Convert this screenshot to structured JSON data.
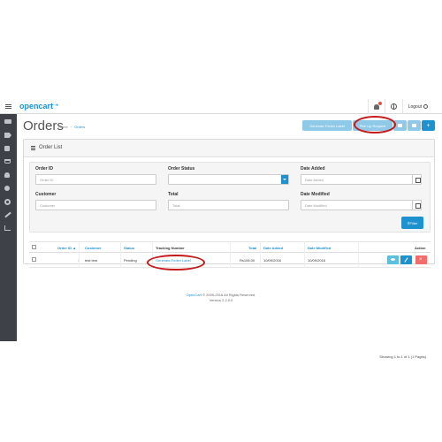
{
  "header": {
    "logo_text": "opencart",
    "logout_label": "Logout"
  },
  "sidebar": {
    "items": [
      {
        "icon": "dashboard-icon"
      },
      {
        "icon": "tag-icon"
      },
      {
        "icon": "puzzle-icon"
      },
      {
        "icon": "shopping-cart-icon"
      },
      {
        "icon": "user-icon"
      },
      {
        "icon": "share-icon"
      },
      {
        "icon": "cog-icon"
      },
      {
        "icon": "wrench-icon"
      },
      {
        "icon": "bar-chart-icon"
      }
    ]
  },
  "page": {
    "title": "Orders",
    "breadcrumb": [
      "Home",
      "Orders"
    ]
  },
  "top_actions": {
    "fedex_label": "Generate Fedex Label",
    "pickup_label": "Pick Up Request",
    "add_label": "+"
  },
  "panel": {
    "title": "Order List"
  },
  "filter": {
    "order_id_label": "Order ID",
    "order_id_placeholder": "Order ID",
    "order_status_label": "Order Status",
    "order_status_value": "",
    "date_added_label": "Date Added",
    "date_added_placeholder": "Date Added",
    "customer_label": "Customer",
    "customer_placeholder": "Customer",
    "total_label": "Total",
    "total_placeholder": "Total",
    "date_modified_label": "Date Modified",
    "date_modified_placeholder": "Date Modified",
    "filter_button": "Filter"
  },
  "table": {
    "headers": {
      "order_id": "Order ID",
      "customer": "Customer",
      "status": "Status",
      "tracking": "Tracking Number",
      "total": "Total",
      "date_added": "Date Added",
      "date_modified": "Date Modified",
      "action": "Action"
    },
    "rows": [
      {
        "order_id": "1",
        "customer": "test test",
        "status": "Pending",
        "tracking": "Generate Fedex Label",
        "total": "Rs106.00",
        "date_added": "10/09/2016",
        "date_modified": "10/09/2016"
      }
    ],
    "showing": "Showing 1 to 1 of 1 (1 Pages)"
  },
  "footer": {
    "brand": "OpenCart",
    "copyright": "© 2009-2016 All Rights Reserved.",
    "version": "Version 2.2.0.0"
  }
}
